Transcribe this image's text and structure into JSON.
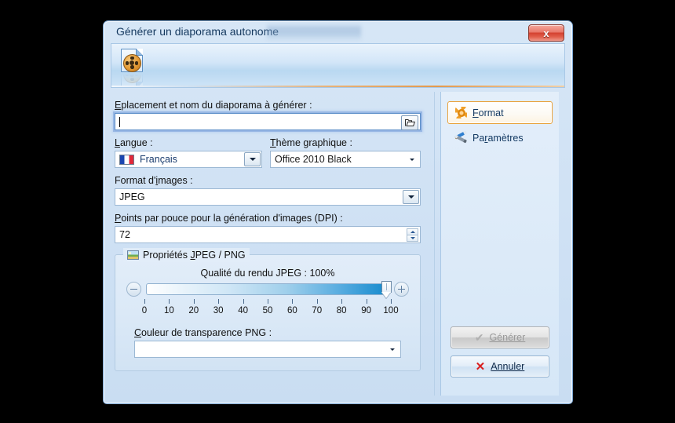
{
  "window": {
    "title": "Générer un diaporama autonome",
    "close_label": "x",
    "banner_icon": "slideshow-document-icon"
  },
  "form": {
    "location_label_pre": "E",
    "location_label_accel": "m",
    "location_label_post": "placement et nom du diaporama à générer :",
    "location_label": "Emplacement et nom du diaporama à générer :",
    "location_value": "",
    "location_placeholder": "",
    "browse_icon": "open-folder-icon",
    "language_label": "Langue :",
    "language_value": "Français",
    "language_flag": "french-flag-icon",
    "theme_label": "Thème graphique :",
    "theme_value": "Office 2010 Black",
    "image_format_label": "Format d'images :",
    "image_format_value": "JPEG",
    "dpi_label": "Points par pouce pour la génération d'images (DPI) :",
    "dpi_value": "72"
  },
  "group": {
    "title": "Propriétés JPEG / PNG",
    "icon": "picture-icon",
    "slider_title": "Qualité du rendu JPEG : 100%",
    "minus_label": "−",
    "plus_label": "+",
    "png_color_label": "Couleur de transparence PNG :",
    "png_color_value": ""
  },
  "sidebar": {
    "items": [
      {
        "label": "Format",
        "icon": "gear-icon",
        "selected": true
      },
      {
        "label": "Paramètres",
        "icon": "tools-icon",
        "selected": false
      }
    ]
  },
  "actions": {
    "generate_label": "Générer",
    "generate_enabled": false,
    "generate_icon": "checkmark-icon",
    "cancel_label": "Annuler",
    "cancel_enabled": true,
    "cancel_icon": "red-x-icon"
  },
  "chart_data": {
    "type": "bar",
    "title": "Qualité du rendu JPEG",
    "categories": [
      "0",
      "10",
      "20",
      "30",
      "40",
      "50",
      "60",
      "70",
      "80",
      "90",
      "100"
    ],
    "values": [
      0,
      10,
      20,
      30,
      40,
      50,
      60,
      70,
      80,
      90,
      100
    ],
    "current_value": 100,
    "xlabel": "",
    "ylabel": "",
    "ylim": [
      0,
      100
    ]
  },
  "colors": {
    "accent": "#e8a13a",
    "slider_fill": "#1f8fd0",
    "close_button": "#d4412f",
    "cancel_x": "#d91f1f",
    "dialog_bg": "#d2e3f4"
  }
}
